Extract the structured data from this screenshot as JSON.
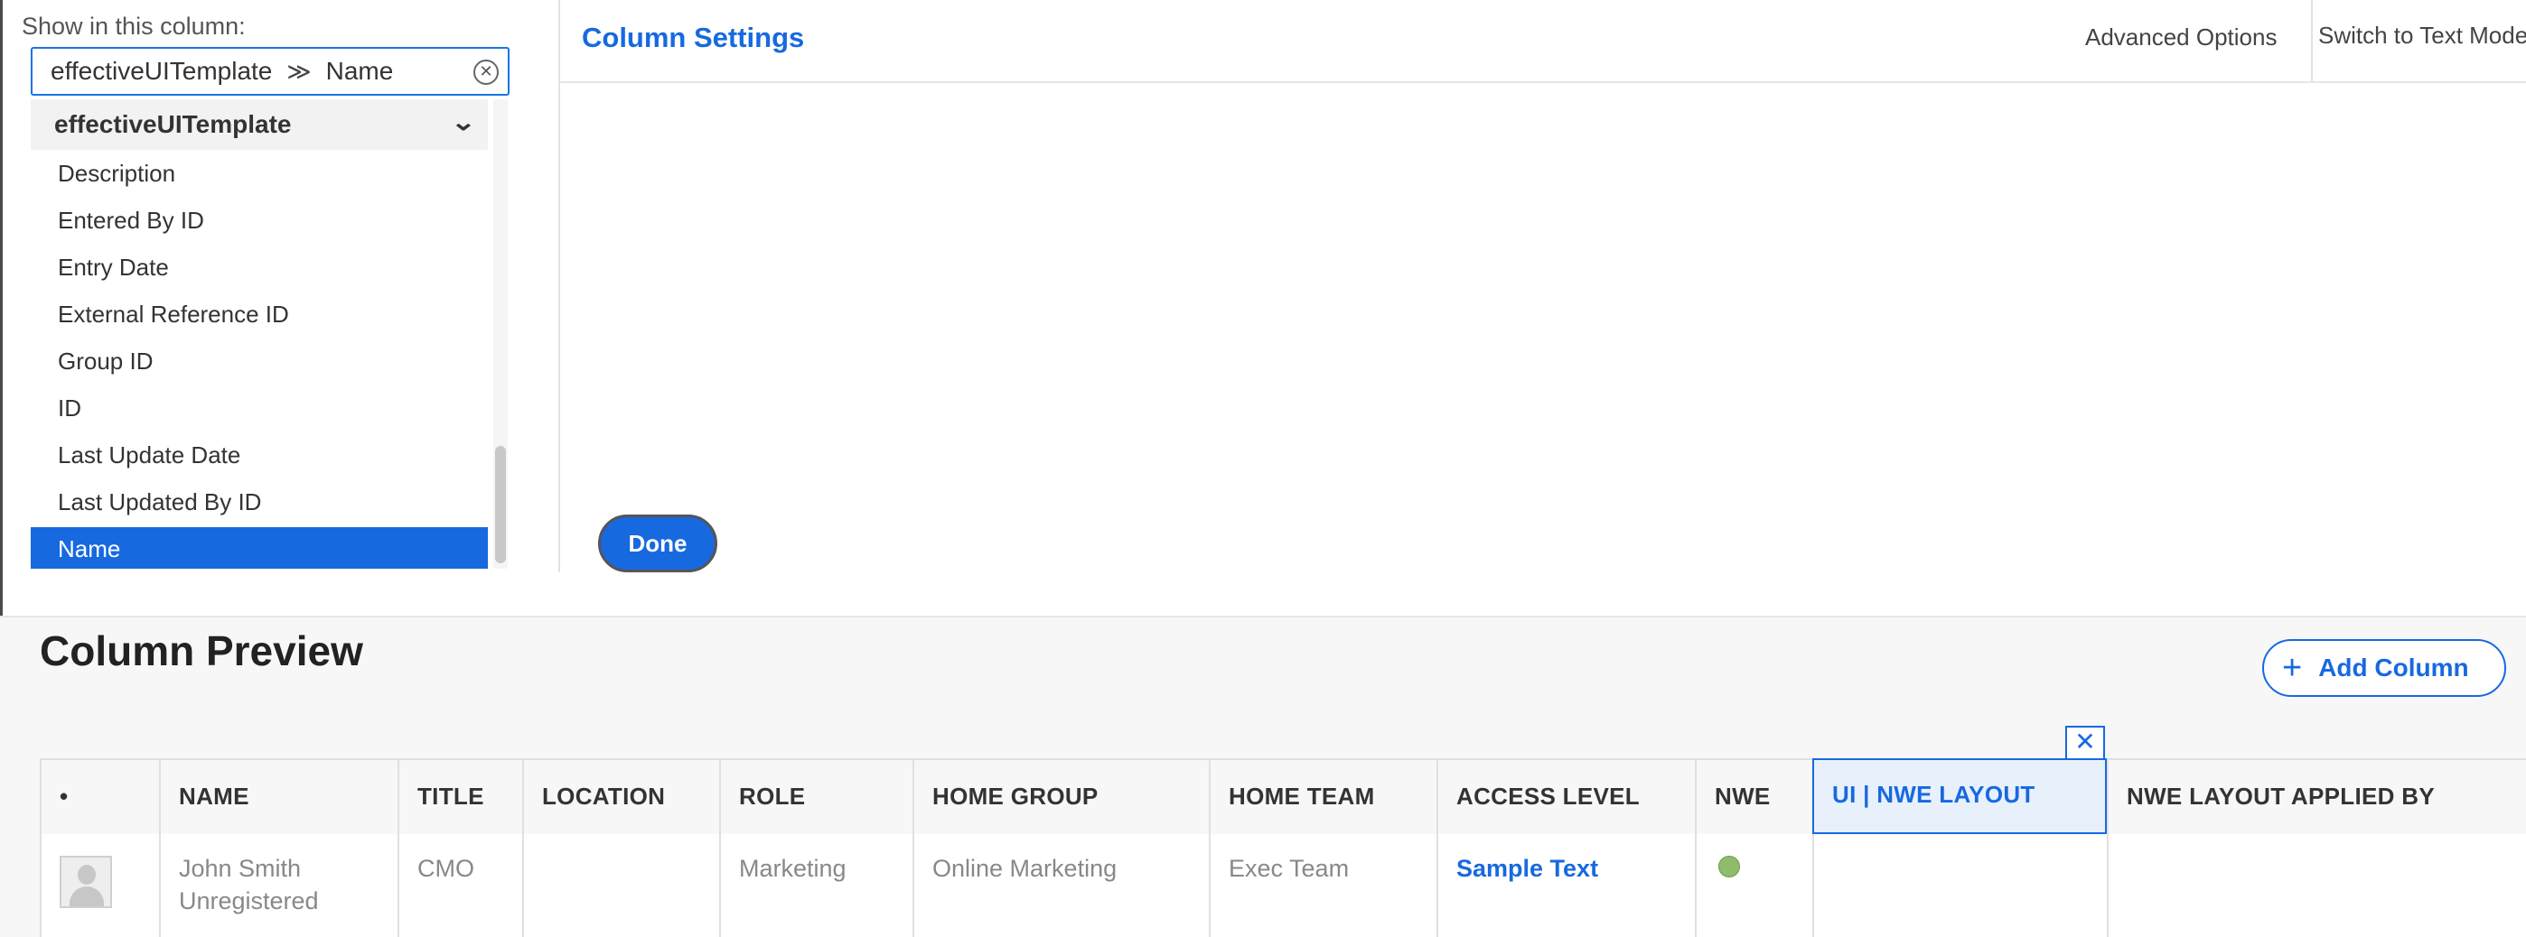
{
  "chooser": {
    "label": "Show in this column:",
    "path": [
      "effectiveUITemplate",
      "Name"
    ],
    "path_separator": "≫",
    "group": "effectiveUITemplate",
    "fields": [
      "Description",
      "Entered By ID",
      "Entry Date",
      "External Reference ID",
      "Group ID",
      "ID",
      "Last Update Date",
      "Last Updated By ID",
      "Name"
    ],
    "selected_field": "Name"
  },
  "settings": {
    "title": "Column Settings",
    "advanced_options": "Advanced Options",
    "switch_text_mode": "Switch to Text Mode",
    "done": "Done"
  },
  "preview": {
    "title": "Column Preview",
    "add_column": "Add Column",
    "close_glyph": "✕",
    "columns": [
      "•",
      "NAME",
      "TITLE",
      "LOCATION",
      "ROLE",
      "HOME GROUP",
      "HOME TEAM",
      "ACCESS LEVEL",
      "NWE",
      "UI | NWE LAYOUT",
      "NWE LAYOUT APPLIED BY"
    ],
    "active_column": "UI | NWE LAYOUT",
    "row": {
      "name_line1": "John Smith",
      "name_line2": "Unregistered",
      "title": "CMO",
      "location": "",
      "role": "Marketing",
      "home_group": "Online Marketing",
      "home_team": "Exec Team",
      "access_level": "Sample Text",
      "nwe_status_color": "#8fbc6a"
    }
  },
  "colors": {
    "accent": "#1769e0"
  }
}
